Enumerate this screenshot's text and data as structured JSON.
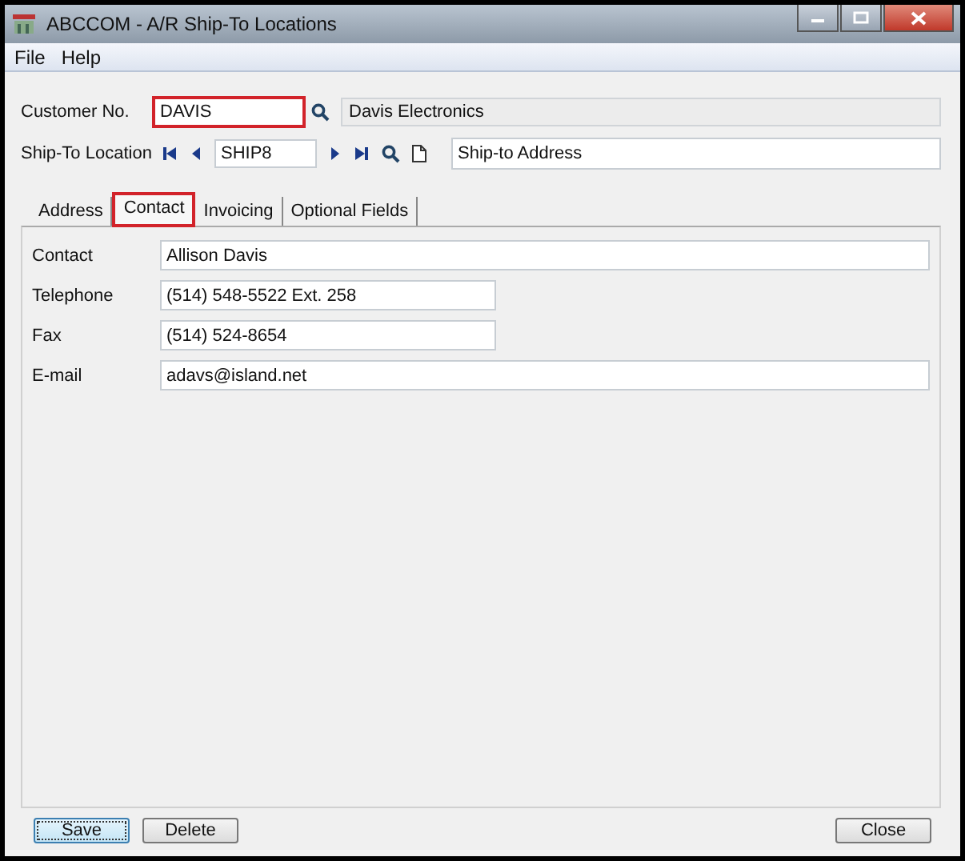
{
  "window": {
    "title": "ABCCOM - A/R Ship-To Locations"
  },
  "menu": [
    "File",
    "Help"
  ],
  "customer": {
    "label": "Customer No.",
    "value": "DAVIS",
    "highlighted": true,
    "name": "Davis Electronics"
  },
  "ship_to": {
    "label": "Ship-To Location",
    "value": "SHIP8",
    "description": "Ship-to Address"
  },
  "tabs": [
    {
      "label": "Address",
      "selected": false,
      "highlighted": false
    },
    {
      "label": "Contact",
      "selected": true,
      "highlighted": true
    },
    {
      "label": "Invoicing",
      "selected": false,
      "highlighted": false
    },
    {
      "label": "Optional Fields",
      "selected": false,
      "highlighted": false
    }
  ],
  "fields": [
    {
      "label": "Contact",
      "value": "Allison Davis",
      "kind": "wide"
    },
    {
      "label": "Telephone",
      "value": "(514) 548-5522 Ext. 258",
      "kind": "short"
    },
    {
      "label": "Fax",
      "value": "(514) 524-8654",
      "kind": "short"
    },
    {
      "label": "E-mail",
      "value": "adavs@island.net",
      "kind": "wide"
    }
  ],
  "buttons": [
    {
      "label": "Save",
      "focused": true
    },
    {
      "label": "Delete",
      "focused": false
    },
    {
      "label": "Close",
      "focused": false
    }
  ]
}
